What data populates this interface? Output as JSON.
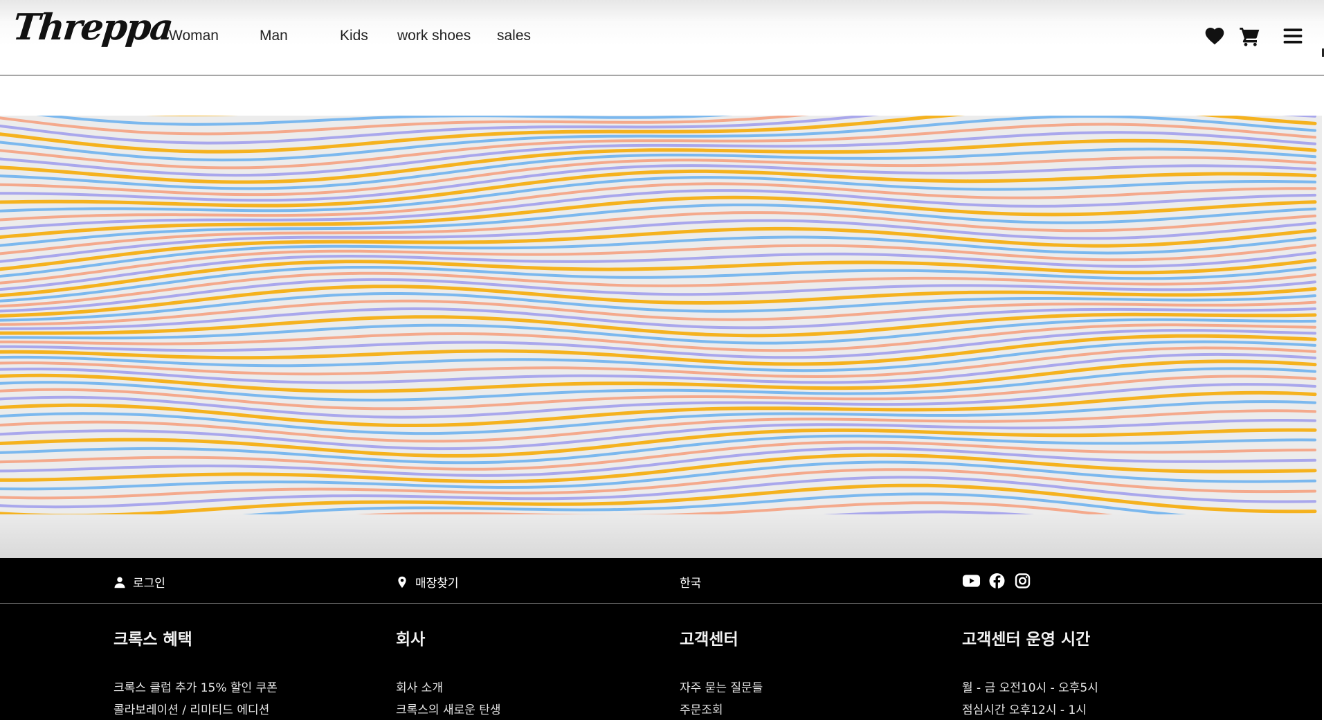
{
  "header": {
    "logo": "Threppa",
    "nav": [
      "Woman",
      "Man",
      "Kids",
      "work shoes",
      "sales"
    ],
    "icons": [
      "heart-icon",
      "cart-icon",
      "hamburger-menu-icon"
    ]
  },
  "banner": {
    "colors": [
      "#f5b21f",
      "#7bb8ee",
      "#f4a98c",
      "#a9a7ec"
    ],
    "background": "#ececec"
  },
  "footer_bar": {
    "login": "로그인",
    "store_finder": "매장찾기",
    "region": "한국",
    "social": [
      "youtube-icon",
      "facebook-icon",
      "instagram-icon"
    ]
  },
  "footer": {
    "benefits": {
      "title": "크록스 혜택",
      "links": [
        "크록스 클럽 추가 15% 할인 쿠폰",
        "콜라보레이션 / 리미티드 에디션"
      ]
    },
    "company": {
      "title": "회사",
      "links": [
        "회사 소개",
        "크록스의 새로운 탄생"
      ]
    },
    "support": {
      "title": "고객센터",
      "links": [
        "자주 묻는 질문들",
        "주문조회"
      ]
    },
    "hours": {
      "title": "고객센터 운영 시간",
      "lines": [
        "월 - 금 오전10시 - 오후5시",
        "점심시간 오후12시 - 1시"
      ]
    }
  }
}
